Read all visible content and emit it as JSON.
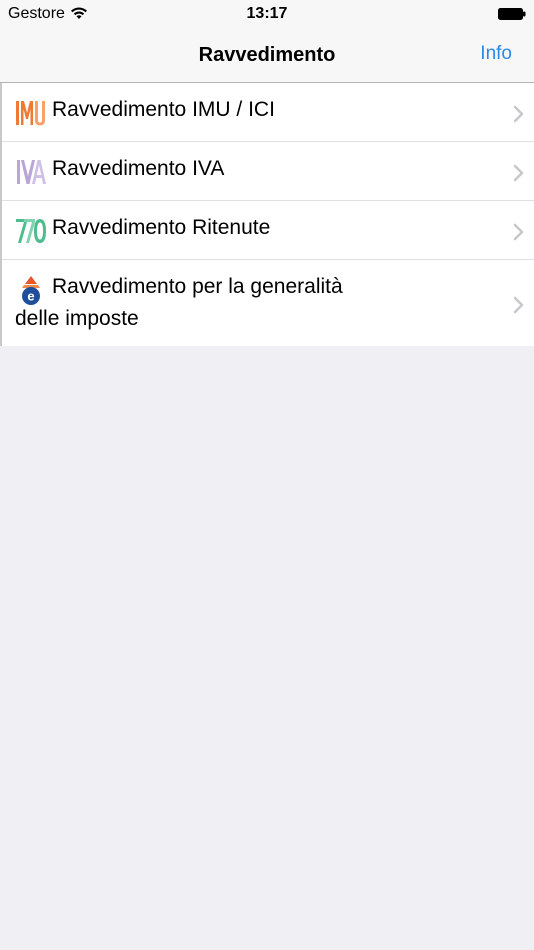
{
  "status_bar": {
    "carrier": "Gestore",
    "time": "13:17"
  },
  "nav": {
    "title": "Ravvedimento",
    "info_label": "Info"
  },
  "list": {
    "items": [
      {
        "label": "Ravvedimento IMU / ICI",
        "icon": "imu-logo-icon"
      },
      {
        "label": "Ravvedimento IVA",
        "icon": "iva-logo-icon"
      },
      {
        "label": "Ravvedimento Ritenute",
        "icon": "770-logo-icon"
      },
      {
        "label_line1": "Ravvedimento per la generalità",
        "label_line2": "delle imposte",
        "icon": "agenzia-entrate-logo-icon"
      }
    ]
  },
  "colors": {
    "accent": "#2b8ae6",
    "background": "#efeff4",
    "imu": "#f07a33",
    "iva": "#b9a6d6",
    "ritenute": "#4dbd8e"
  }
}
